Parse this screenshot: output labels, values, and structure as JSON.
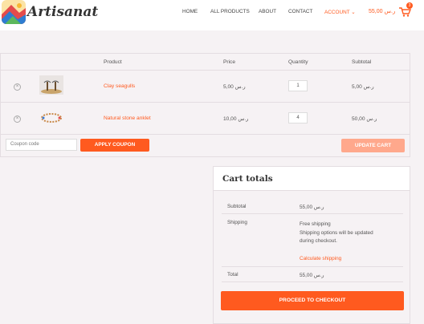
{
  "brand": {
    "name": "Artisanat"
  },
  "nav": {
    "home": "HOME",
    "all_products": "ALL PRODUCTS",
    "about": "ABOUT",
    "contact": "CONTACT",
    "account": "ACCOUNT",
    "cart_amount": "ر.س 55,00",
    "cart_count": "3"
  },
  "table": {
    "headers": {
      "product": "Product",
      "price": "Price",
      "quantity": "Quantity",
      "subtotal": "Subtotal"
    },
    "rows": [
      {
        "name": "Clay seagulls",
        "price": "ر.س 5,00",
        "qty": "1",
        "subtotal": "ر.س 5,00"
      },
      {
        "name": "Natural stone anklet",
        "price": "ر.س 10,00",
        "qty": "4",
        "subtotal": "ر.س 50,00"
      }
    ]
  },
  "coupon": {
    "placeholder": "Coupon code",
    "apply": "APPLY COUPON",
    "update": "UPDATE CART"
  },
  "totals": {
    "title": "Cart totals",
    "subtotal_label": "Subtotal",
    "subtotal_value": "ر.س 55,00",
    "shipping_label": "Shipping",
    "shipping_line1": "Free shipping",
    "shipping_line2": "Shipping options will be updated",
    "shipping_line3": "during checkout.",
    "calc_shipping": "Calculate shipping",
    "total_label": "Total",
    "total_value": "ر.س 55,00",
    "checkout": "PROCEED TO CHECKOUT"
  },
  "colors": {
    "accent": "#ff5a1f",
    "accent_light": "#ffa88c",
    "background": "#f6f2f4"
  }
}
